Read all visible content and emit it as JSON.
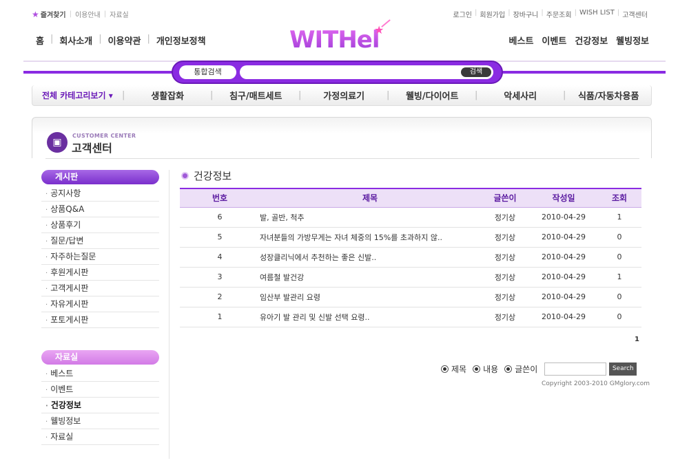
{
  "util_left": {
    "favorite": "즐겨찾기",
    "guide": "이용안내",
    "archive": "자료실"
  },
  "util_right": [
    "로그인",
    "회원가입",
    "장바구니",
    "주문조회",
    "WISH LIST",
    "고객센터"
  ],
  "main_nav_left": [
    "홈",
    "회사소개",
    "이용약관",
    "개인정보정책"
  ],
  "main_nav_right": [
    "베스트",
    "이벤트",
    "건강정보",
    "웰빙정보"
  ],
  "logo": "WITHel",
  "search": {
    "scope": "통합검색",
    "button": "검색"
  },
  "categories": {
    "all": "전체 카테고리보기",
    "items": [
      "생활잡화",
      "침구/매트세트",
      "가정의료기",
      "웰빙/다이어트",
      "악세사리",
      "식품/자동차용품"
    ]
  },
  "customer_center": {
    "en": "CUSTOMER CENTER",
    "ko": "고객센터"
  },
  "sidebar": {
    "board_title": "게시판",
    "board_items": [
      "공지사항",
      "상품Q&A",
      "상품후기",
      "질문/답변",
      "자주하는질문",
      "후원게시판",
      "고객게시판",
      "자유게시판",
      "포토게시판"
    ],
    "data_title": "자료실",
    "data_items": [
      "베스트",
      "이벤트",
      "건강정보",
      "웰빙정보",
      "자료실"
    ],
    "active": "건강정보"
  },
  "section_title": "건강정보",
  "table": {
    "headers": [
      "번호",
      "제목",
      "글쓴이",
      "작성일",
      "조회"
    ],
    "rows": [
      {
        "no": "6",
        "title": "발, 골반, 척추",
        "writer": "정기상",
        "date": "2010-04-29",
        "hits": "1"
      },
      {
        "no": "5",
        "title": "자녀분들의 가방무게는 자녀 체중의 15%를 초과하지 않..",
        "writer": "정기상",
        "date": "2010-04-29",
        "hits": "0"
      },
      {
        "no": "4",
        "title": "성장클리닉에서 추천하는 좋은 신발..",
        "writer": "정기상",
        "date": "2010-04-29",
        "hits": "0"
      },
      {
        "no": "3",
        "title": "여름철 발건강",
        "writer": "정기상",
        "date": "2010-04-29",
        "hits": "1"
      },
      {
        "no": "2",
        "title": "임산부 발관리 요령",
        "writer": "정기상",
        "date": "2010-04-29",
        "hits": "0"
      },
      {
        "no": "1",
        "title": "유아기 발 관리 및 신발 선택 요령..",
        "writer": "정기상",
        "date": "2010-04-29",
        "hits": "0"
      }
    ]
  },
  "pager": "1",
  "search_options": [
    "제목",
    "내용",
    "글쓴이"
  ],
  "search_button": "Search",
  "copyright": "Copyright 2003-2010 GMglory.com"
}
